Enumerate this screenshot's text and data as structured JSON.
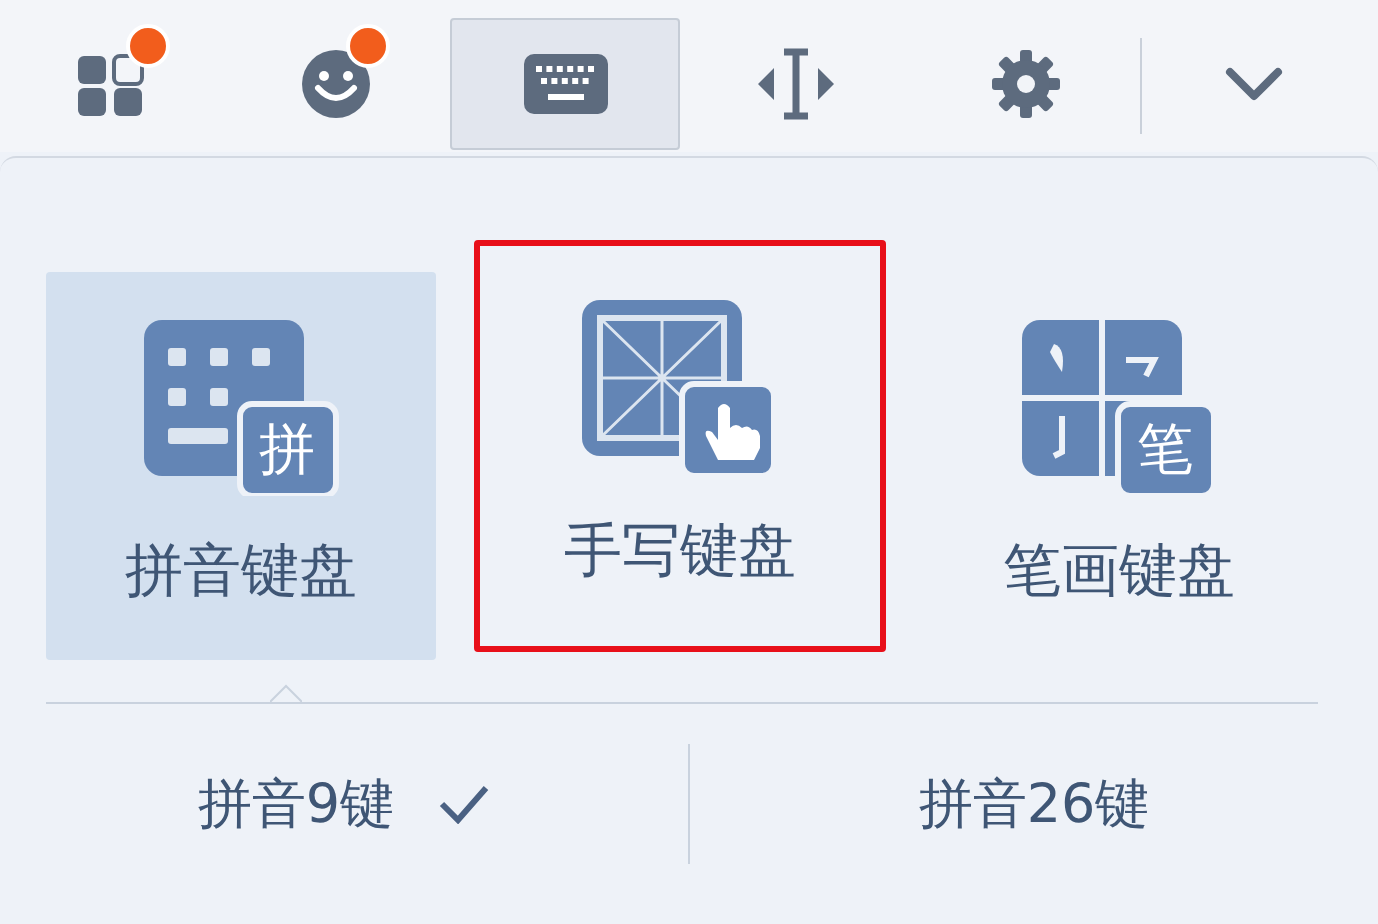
{
  "toolbar": [
    {
      "kind": "apps",
      "badge": true,
      "selected": false
    },
    {
      "kind": "emoji",
      "badge": true,
      "selected": false
    },
    {
      "kind": "keyboard",
      "badge": false,
      "selected": true
    },
    {
      "kind": "cursor",
      "badge": false,
      "selected": false
    },
    {
      "kind": "settings",
      "badge": false,
      "selected": false
    },
    {
      "kind": "collapse",
      "badge": false,
      "selected": false
    }
  ],
  "layouts": [
    {
      "kind": "pinyin",
      "label": "拼音键盘",
      "badge_char": "拼",
      "selected": true,
      "highlighted": false
    },
    {
      "kind": "handwriting",
      "label": "手写键盘",
      "selected": false,
      "highlighted": true
    },
    {
      "kind": "stroke",
      "label": "笔画键盘",
      "badge_char": "笔",
      "selected": false,
      "highlighted": false
    }
  ],
  "pinyin_modes": [
    {
      "label": "拼音9键",
      "checked": true
    },
    {
      "label": "拼音26键",
      "checked": false
    }
  ]
}
